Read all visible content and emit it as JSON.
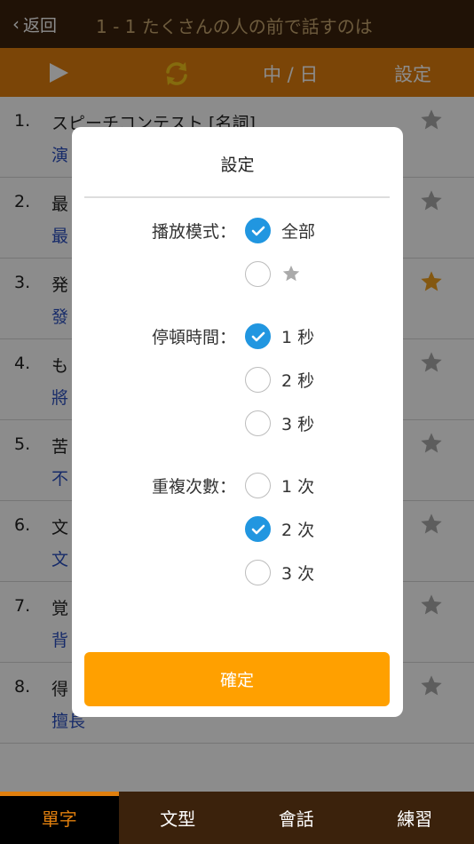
{
  "header": {
    "back_label": "返回",
    "title": "1 - 1 たくさんの人の前で話すのは"
  },
  "toolbar": {
    "lang_label": "中 / 日",
    "settings_label": "設定"
  },
  "list": {
    "rows": [
      {
        "num": "1.",
        "jp": "スピーチコンテスト [名詞]",
        "zh": "演",
        "starred": false
      },
      {
        "num": "2.",
        "jp": "最",
        "zh": "最",
        "starred": false
      },
      {
        "num": "3.",
        "jp": "発",
        "zh": "發",
        "starred": true
      },
      {
        "num": "4.",
        "jp": "も",
        "zh": "將",
        "starred": false
      },
      {
        "num": "5.",
        "jp": "苦",
        "zh": "不",
        "starred": false
      },
      {
        "num": "6.",
        "jp": "文",
        "zh": "文",
        "starred": false
      },
      {
        "num": "7.",
        "jp": "覚",
        "zh": "背",
        "starred": false
      },
      {
        "num": "8.",
        "jp": "得",
        "zh": "擅長",
        "starred": false
      }
    ]
  },
  "modal": {
    "title": "設定",
    "play_mode": {
      "label": "播放模式：",
      "options": [
        {
          "label": "全部",
          "selected": true
        },
        {
          "label": "",
          "icon": "star-icon",
          "selected": false
        }
      ]
    },
    "pause_time": {
      "label": "停頓時間：",
      "options": [
        {
          "label": "1 秒",
          "selected": true
        },
        {
          "label": "2 秒",
          "selected": false
        },
        {
          "label": "3 秒",
          "selected": false
        }
      ]
    },
    "repeat_count": {
      "label": "重複次數：",
      "options": [
        {
          "label": "1 次",
          "selected": false
        },
        {
          "label": "2 次",
          "selected": true
        },
        {
          "label": "3 次",
          "selected": false
        }
      ]
    },
    "confirm_label": "確定"
  },
  "tabs": [
    {
      "label": "單字",
      "active": true
    },
    {
      "label": "文型",
      "active": false
    },
    {
      "label": "會話",
      "active": false
    },
    {
      "label": "練習",
      "active": false
    }
  ],
  "colors": {
    "header_bg": "#3b220c",
    "toolbar_bg": "#e07f0e",
    "accent_orange": "#ffa000",
    "radio_selected": "#2196e0",
    "star_active": "#f0a020",
    "star_inactive": "#aaaaaa"
  }
}
